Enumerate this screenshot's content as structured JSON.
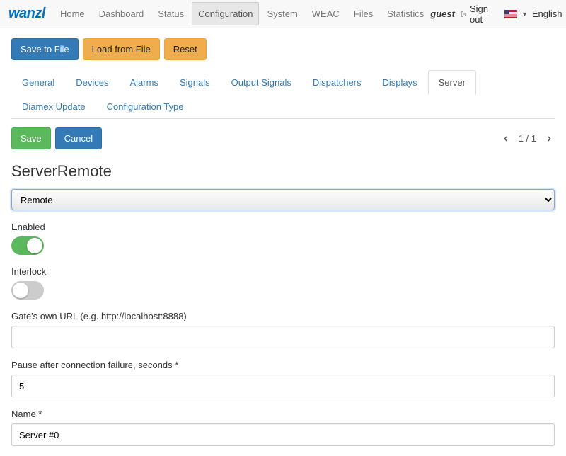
{
  "header": {
    "logo": "wanzl",
    "nav": [
      "Home",
      "Dashboard",
      "Status",
      "Configuration",
      "System",
      "WEAC",
      "Files",
      "Statistics"
    ],
    "active_nav": "Configuration",
    "user": "guest",
    "signout": "Sign out",
    "language": "English"
  },
  "toolbar": {
    "save_to_file": "Save to File",
    "load_from_file": "Load from File",
    "reset": "Reset"
  },
  "tabs": {
    "items": [
      "General",
      "Devices",
      "Alarms",
      "Signals",
      "Output Signals",
      "Dispatchers",
      "Displays",
      "Server",
      "Diamex Update",
      "Configuration Type"
    ],
    "active": "Server"
  },
  "actions": {
    "save": "Save",
    "cancel": "Cancel"
  },
  "pager": {
    "text": "1 / 1"
  },
  "panel": {
    "title": "ServerRemote",
    "select_value": "Remote",
    "fields": {
      "enabled": {
        "label": "Enabled",
        "value": true
      },
      "interlock": {
        "label": "Interlock",
        "value": false
      },
      "gate_url": {
        "label": "Gate's own URL (e.g. http://localhost:8888)",
        "value": ""
      },
      "pause": {
        "label": "Pause after connection failure, seconds *",
        "value": "5"
      },
      "name": {
        "label": "Name *",
        "value": "Server #0"
      }
    }
  }
}
